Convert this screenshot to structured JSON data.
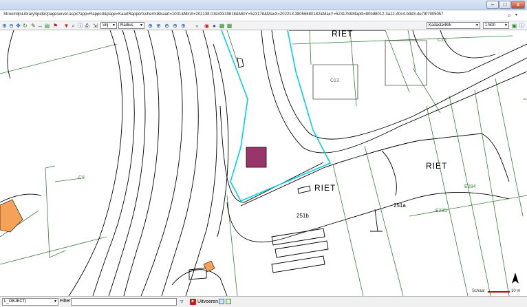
{
  "window": {
    "minimize_glyph": "–",
    "maximize_glyph": "□",
    "close_glyph": "x"
  },
  "address_bar": {
    "url": "StroomlijnLibrarySpider/pageserver.aspx?app=Rapport&page=KaartRapportschermt&kaart=1001&MinX=202138.01943319818&MinY=523178&MaxX=202213.38056680182&MaxY=523178&Mapltl=80bd8012-3a12-40c4-b9d3-de78f7905057",
    "search_icon": "magnifier-icon",
    "dropdown_icon": "chevron-down-icon"
  },
  "toolbar": {
    "mode_select": "Vrij",
    "radius_select": "Radius",
    "layer_select": "KadasterBrk",
    "scale_select": "1:500",
    "icons": [
      "zoom-in-icon",
      "zoom-out-icon",
      "pan-icon",
      "refresh-icon",
      "select-icon",
      "measure-icon",
      "layers-icon",
      "flag-icon",
      "pin-icon",
      "search-icon",
      "identify-icon",
      "print-icon",
      "export-icon",
      "stop-icon",
      "globe-icon",
      "map-icon",
      "grid-icon"
    ]
  },
  "map": {
    "labels": {
      "riet_top": "RIET",
      "riet_right": "RIET",
      "riet_center": "RIET",
      "c15": "C15",
      "c13": "C13",
      "c8": "C8",
      "e284": "E284",
      "e285": "E285",
      "p251a": "251a",
      "p251b": "251b"
    },
    "colors": {
      "parcel_line": "#3a7d3a",
      "road_line": "#000000",
      "selection_line": "#00d0e8",
      "marker_fill": "#9b3468",
      "building_fill": "#f5a15a"
    }
  },
  "scale": {
    "label": "Schaal",
    "value": "10 m"
  },
  "statusbar": {
    "layer_select": "L_OBJECT)",
    "filter_label": "Filter",
    "filter_value": "",
    "run_label": "Uitvoeren"
  }
}
